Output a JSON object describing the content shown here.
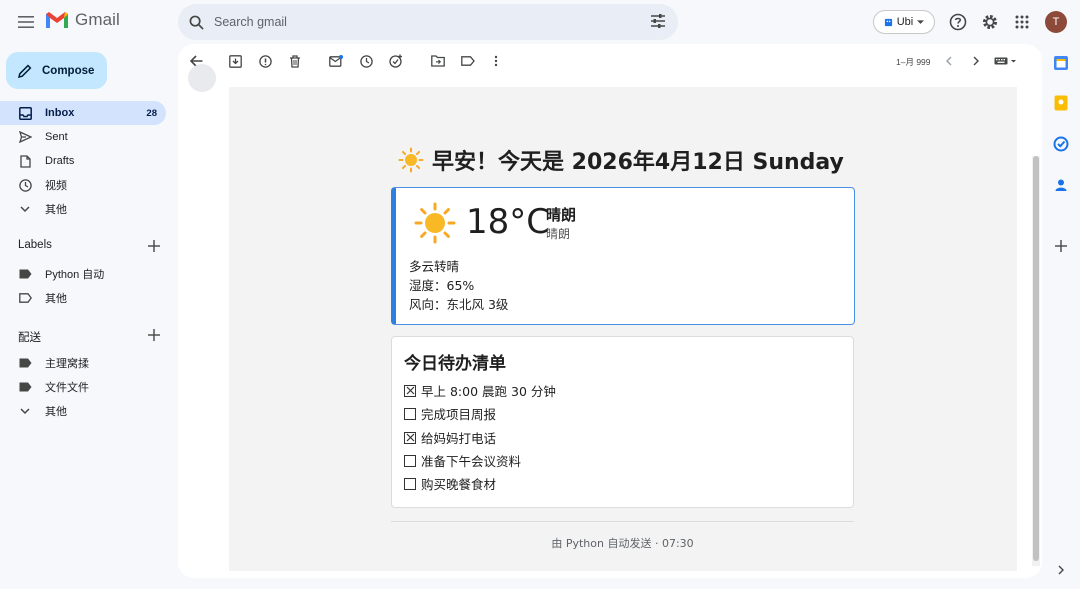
{
  "app": {
    "logo_text": "Gmail",
    "search_placeholder": "Search gmail",
    "account_chip": "Ubi",
    "avatar_letter": "T"
  },
  "nav": {
    "compose": "Compose",
    "items": [
      {
        "label": "Inbox",
        "count": "28",
        "icon": "inbox-icon",
        "active": true
      },
      {
        "label": "Sent",
        "icon": "send-icon"
      },
      {
        "label": "Drafts",
        "icon": "draft-icon"
      },
      {
        "label": "视频",
        "icon": "clock-icon"
      },
      {
        "label": "其他",
        "icon": "chevron-down-icon"
      }
    ],
    "labels_title": "Labels",
    "labels": [
      {
        "label": "Python 自动",
        "icon": "label-filled-icon"
      },
      {
        "label": "其他",
        "icon": "label-outline-icon"
      }
    ],
    "section2_title": "配送",
    "section2": [
      {
        "label": "主理窝揉",
        "icon": "label-filled-icon"
      },
      {
        "label": "文件文件",
        "icon": "label-filled-icon"
      },
      {
        "label": "其他",
        "icon": "chevron-down-icon"
      }
    ]
  },
  "toolbar": {
    "pager": "1–月 999"
  },
  "email": {
    "greeting": "早安！今天是 2026年4月12日 Sunday",
    "weather": {
      "temp": "18°C",
      "condition": "晴朗",
      "condition_sub": "晴朗",
      "forecast": "多云转晴",
      "humidity": "湿度：65%",
      "wind": "风向：东北风 3级"
    },
    "todo": {
      "title": "今日待办清单",
      "items": [
        {
          "text": "早上 8:00 晨跑 30 分钟",
          "checked": true
        },
        {
          "text": "完成项目周报",
          "checked": false
        },
        {
          "text": "给妈妈打电话",
          "checked": true
        },
        {
          "text": "准备下午会议资料",
          "checked": false
        },
        {
          "text": "购买晚餐食材",
          "checked": false
        }
      ]
    },
    "footer": "由 Python 自动发送 · 07:30"
  },
  "colors": {
    "compose_bg": "#c2e7ff",
    "active_nav_bg": "#d3e3fd",
    "weather_accent": "#2f7fe0"
  }
}
